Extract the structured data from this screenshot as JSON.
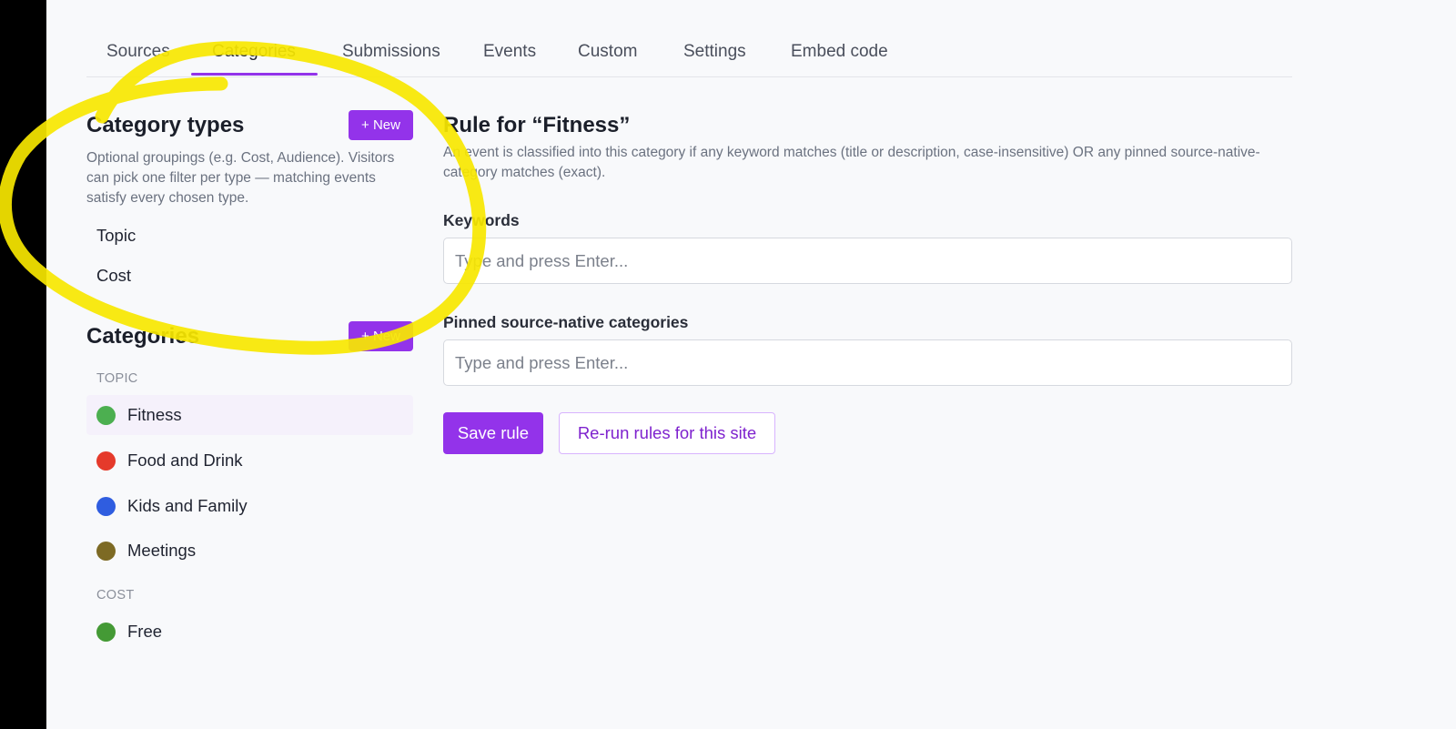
{
  "nav": {
    "tabs": [
      {
        "label": "Sources"
      },
      {
        "label": "Categories"
      },
      {
        "label": "Submissions"
      },
      {
        "label": "Events"
      },
      {
        "label": "Custom"
      },
      {
        "label": "Settings"
      },
      {
        "label": "Embed code"
      }
    ],
    "active_tab": "Categories"
  },
  "category_types": {
    "title": "Category types",
    "new_label": "+ New",
    "description": "Optional groupings (e.g. Cost, Audience). Visitors can pick one filter per type — matching events satisfy every chosen type.",
    "items": [
      {
        "label": "Topic"
      },
      {
        "label": "Cost"
      }
    ]
  },
  "categories": {
    "title": "Categories",
    "new_label": "+ New",
    "groups": [
      {
        "label": "TOPIC",
        "items": [
          {
            "label": "Fitness",
            "color": "#4caf50",
            "selected": true
          },
          {
            "label": "Food and Drink",
            "color": "#e53a2b"
          },
          {
            "label": "Kids and Family",
            "color": "#2f5de0"
          },
          {
            "label": "Meetings",
            "color": "#7d6a24"
          }
        ]
      },
      {
        "label": "COST",
        "items": [
          {
            "label": "Free",
            "color": "#449a35"
          }
        ]
      }
    ]
  },
  "rule": {
    "title": "Rule for “Fitness”",
    "description": "An event is classified into this category if any keyword matches (title or description, case-insensitive) OR any pinned source-native-category matches (exact).",
    "keywords": {
      "label": "Keywords",
      "value": "",
      "placeholder": "Type and press Enter..."
    },
    "pinned": {
      "label": "Pinned source-native categories",
      "value": "",
      "placeholder": "Type and press Enter..."
    },
    "save_label": "Save rule",
    "rerun_label": "Re-run rules for this site"
  },
  "colors": {
    "accent": "#9333ea",
    "annotation": "#f7e700"
  }
}
